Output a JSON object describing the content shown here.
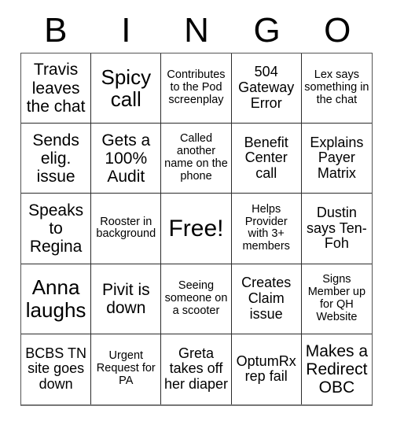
{
  "card": {
    "header_letters": [
      "B",
      "I",
      "N",
      "G",
      "O"
    ],
    "free_space_label": "Free!",
    "cells": [
      {
        "text": "Travis leaves the chat",
        "size": "lg"
      },
      {
        "text": "Spicy call",
        "size": "xl"
      },
      {
        "text": "Contributes to the Pod screenplay",
        "size": "sm"
      },
      {
        "text": "504 Gateway Error",
        "size": "md"
      },
      {
        "text": "Lex says something in the chat",
        "size": "sm"
      },
      {
        "text": "Sends elig. issue",
        "size": "lg"
      },
      {
        "text": "Gets a 100% Audit",
        "size": "lg"
      },
      {
        "text": "Called another name on the phone",
        "size": "sm"
      },
      {
        "text": "Benefit Center call",
        "size": "md"
      },
      {
        "text": "Explains Payer Matrix",
        "size": "md"
      },
      {
        "text": "Speaks to Regina",
        "size": "lg"
      },
      {
        "text": "Rooster in background",
        "size": "sm"
      },
      {
        "text": "Free!",
        "size": "free"
      },
      {
        "text": "Helps Provider with 3+ members",
        "size": "sm"
      },
      {
        "text": "Dustin says Ten-Foh",
        "size": "md"
      },
      {
        "text": "Anna laughs",
        "size": "xl"
      },
      {
        "text": "Pivit is down",
        "size": "lg"
      },
      {
        "text": "Seeing someone on a scooter",
        "size": "sm"
      },
      {
        "text": "Creates Claim issue",
        "size": "md"
      },
      {
        "text": "Signs Member up for QH Website",
        "size": "sm"
      },
      {
        "text": "BCBS TN site goes down",
        "size": "md"
      },
      {
        "text": "Urgent Request for PA",
        "size": "sm"
      },
      {
        "text": "Greta takes off her diaper",
        "size": "md"
      },
      {
        "text": "OptumRx rep fail",
        "size": "md"
      },
      {
        "text": "Makes a Redirect OBC",
        "size": "lg"
      }
    ]
  },
  "colors": {
    "background": "#ffffff",
    "text": "#000000",
    "cell_border": "#2b2b2b",
    "outer_border": "#555555"
  }
}
